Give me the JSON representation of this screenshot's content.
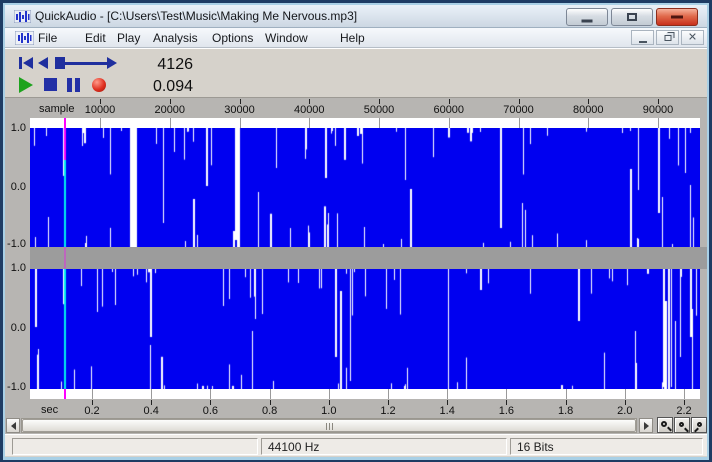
{
  "window": {
    "title": "QuickAudio - [C:\\Users\\Test\\Music\\Making Me Nervous.mp3]"
  },
  "menu_bar": {
    "items": [
      "File",
      "Edit",
      "Play",
      "Analysis",
      "Options",
      "Window",
      "Help"
    ]
  },
  "transport": {
    "counter_sample": "4126",
    "counter_seconds": "0.094"
  },
  "rulers": {
    "sample": {
      "unit_label": "sample",
      "ticks": [
        "10000",
        "20000",
        "30000",
        "40000",
        "50000",
        "60000",
        "70000",
        "80000",
        "90000"
      ]
    },
    "seconds": {
      "unit_label": "sec",
      "ticks": [
        "0.2",
        "0.4",
        "0.6",
        "0.8",
        "1.0",
        "1.2",
        "1.4",
        "1.6",
        "1.8",
        "2.0",
        "2.2"
      ]
    }
  },
  "amplitude_axis": {
    "labels": [
      "1.0",
      "0.0",
      "-1.0"
    ]
  },
  "status_bar": {
    "panels": [
      "",
      "44100 Hz",
      "16 Bits"
    ]
  },
  "colors": {
    "waveform_blue": "#0000f0",
    "cursor_magenta": "#ff00ff",
    "cursor_cyan": "#00eeee",
    "play_green": "#1da31d",
    "transport_navy": "#1f2f9e",
    "record_red": "#d42818",
    "separator_gray": "#9c9c9c"
  }
}
